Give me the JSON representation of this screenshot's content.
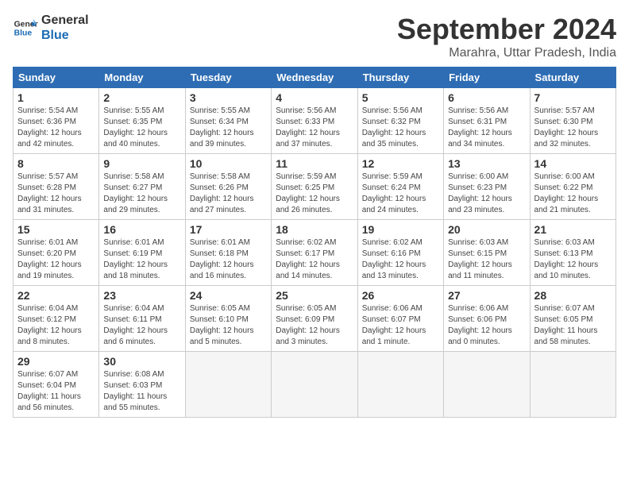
{
  "logo": {
    "line1": "General",
    "line2": "Blue"
  },
  "title": "September 2024",
  "location": "Marahra, Uttar Pradesh, India",
  "weekdays": [
    "Sunday",
    "Monday",
    "Tuesday",
    "Wednesday",
    "Thursday",
    "Friday",
    "Saturday"
  ],
  "days": [
    {
      "num": "",
      "info": ""
    },
    {
      "num": "",
      "info": ""
    },
    {
      "num": "",
      "info": ""
    },
    {
      "num": "1",
      "info": "Sunrise: 5:54 AM\nSunset: 6:36 PM\nDaylight: 12 hours\nand 42 minutes."
    },
    {
      "num": "2",
      "info": "Sunrise: 5:55 AM\nSunset: 6:35 PM\nDaylight: 12 hours\nand 40 minutes."
    },
    {
      "num": "3",
      "info": "Sunrise: 5:55 AM\nSunset: 6:34 PM\nDaylight: 12 hours\nand 39 minutes."
    },
    {
      "num": "4",
      "info": "Sunrise: 5:56 AM\nSunset: 6:33 PM\nDaylight: 12 hours\nand 37 minutes."
    },
    {
      "num": "5",
      "info": "Sunrise: 5:56 AM\nSunset: 6:32 PM\nDaylight: 12 hours\nand 35 minutes."
    },
    {
      "num": "6",
      "info": "Sunrise: 5:56 AM\nSunset: 6:31 PM\nDaylight: 12 hours\nand 34 minutes."
    },
    {
      "num": "7",
      "info": "Sunrise: 5:57 AM\nSunset: 6:30 PM\nDaylight: 12 hours\nand 32 minutes."
    },
    {
      "num": "8",
      "info": "Sunrise: 5:57 AM\nSunset: 6:28 PM\nDaylight: 12 hours\nand 31 minutes."
    },
    {
      "num": "9",
      "info": "Sunrise: 5:58 AM\nSunset: 6:27 PM\nDaylight: 12 hours\nand 29 minutes."
    },
    {
      "num": "10",
      "info": "Sunrise: 5:58 AM\nSunset: 6:26 PM\nDaylight: 12 hours\nand 27 minutes."
    },
    {
      "num": "11",
      "info": "Sunrise: 5:59 AM\nSunset: 6:25 PM\nDaylight: 12 hours\nand 26 minutes."
    },
    {
      "num": "12",
      "info": "Sunrise: 5:59 AM\nSunset: 6:24 PM\nDaylight: 12 hours\nand 24 minutes."
    },
    {
      "num": "13",
      "info": "Sunrise: 6:00 AM\nSunset: 6:23 PM\nDaylight: 12 hours\nand 23 minutes."
    },
    {
      "num": "14",
      "info": "Sunrise: 6:00 AM\nSunset: 6:22 PM\nDaylight: 12 hours\nand 21 minutes."
    },
    {
      "num": "15",
      "info": "Sunrise: 6:01 AM\nSunset: 6:20 PM\nDaylight: 12 hours\nand 19 minutes."
    },
    {
      "num": "16",
      "info": "Sunrise: 6:01 AM\nSunset: 6:19 PM\nDaylight: 12 hours\nand 18 minutes."
    },
    {
      "num": "17",
      "info": "Sunrise: 6:01 AM\nSunset: 6:18 PM\nDaylight: 12 hours\nand 16 minutes."
    },
    {
      "num": "18",
      "info": "Sunrise: 6:02 AM\nSunset: 6:17 PM\nDaylight: 12 hours\nand 14 minutes."
    },
    {
      "num": "19",
      "info": "Sunrise: 6:02 AM\nSunset: 6:16 PM\nDaylight: 12 hours\nand 13 minutes."
    },
    {
      "num": "20",
      "info": "Sunrise: 6:03 AM\nSunset: 6:15 PM\nDaylight: 12 hours\nand 11 minutes."
    },
    {
      "num": "21",
      "info": "Sunrise: 6:03 AM\nSunset: 6:13 PM\nDaylight: 12 hours\nand 10 minutes."
    },
    {
      "num": "22",
      "info": "Sunrise: 6:04 AM\nSunset: 6:12 PM\nDaylight: 12 hours\nand 8 minutes."
    },
    {
      "num": "23",
      "info": "Sunrise: 6:04 AM\nSunset: 6:11 PM\nDaylight: 12 hours\nand 6 minutes."
    },
    {
      "num": "24",
      "info": "Sunrise: 6:05 AM\nSunset: 6:10 PM\nDaylight: 12 hours\nand 5 minutes."
    },
    {
      "num": "25",
      "info": "Sunrise: 6:05 AM\nSunset: 6:09 PM\nDaylight: 12 hours\nand 3 minutes."
    },
    {
      "num": "26",
      "info": "Sunrise: 6:06 AM\nSunset: 6:07 PM\nDaylight: 12 hours\nand 1 minute."
    },
    {
      "num": "27",
      "info": "Sunrise: 6:06 AM\nSunset: 6:06 PM\nDaylight: 12 hours\nand 0 minutes."
    },
    {
      "num": "28",
      "info": "Sunrise: 6:07 AM\nSunset: 6:05 PM\nDaylight: 11 hours\nand 58 minutes."
    },
    {
      "num": "29",
      "info": "Sunrise: 6:07 AM\nSunset: 6:04 PM\nDaylight: 11 hours\nand 56 minutes."
    },
    {
      "num": "30",
      "info": "Sunrise: 6:08 AM\nSunset: 6:03 PM\nDaylight: 11 hours\nand 55 minutes."
    },
    {
      "num": "",
      "info": ""
    },
    {
      "num": "",
      "info": ""
    },
    {
      "num": "",
      "info": ""
    },
    {
      "num": "",
      "info": ""
    },
    {
      "num": "",
      "info": ""
    }
  ]
}
